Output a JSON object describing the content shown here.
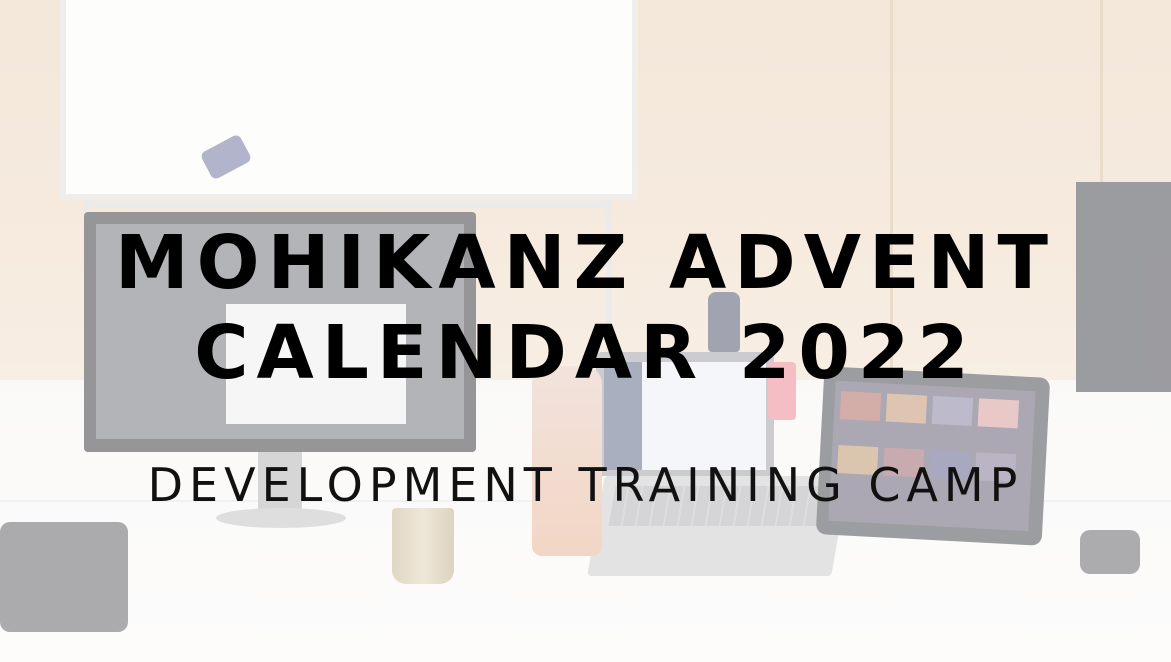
{
  "banner": {
    "title_line1": "MOHIKANZ ADVENT",
    "title_line2": "CALENDAR 2022",
    "subtitle": "DEVELOPMENT TRAINING CAMP"
  },
  "colors": {
    "title_text": "#000000",
    "photo_wash": "rgba(255,255,255,0.42)"
  }
}
